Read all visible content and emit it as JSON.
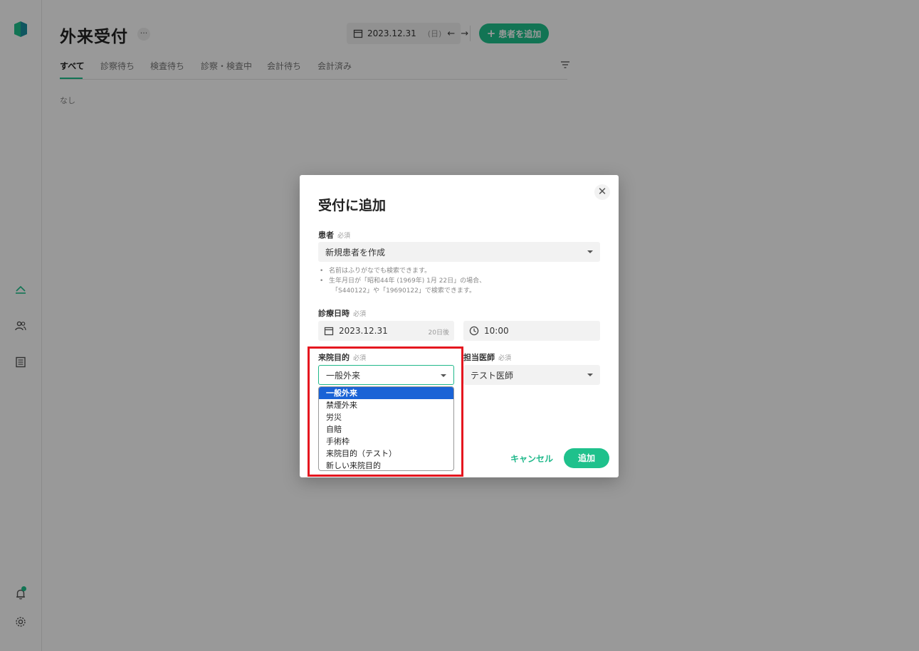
{
  "sidebar": {
    "items": [
      {
        "icon": "reception-icon",
        "active": true
      },
      {
        "icon": "patients-icon"
      },
      {
        "icon": "records-icon"
      }
    ],
    "bottom": [
      {
        "icon": "notification-bell-icon",
        "has_badge": true
      },
      {
        "icon": "gear-icon"
      }
    ]
  },
  "header": {
    "title": "外来受付",
    "more": "···",
    "date": "2023.12.31",
    "day_of_week": "(日)",
    "prev": "←",
    "next": "→",
    "add_patient_plus": "+",
    "add_patient_label": "患者を追加"
  },
  "tabs": [
    {
      "label": "すべて",
      "active": true
    },
    {
      "label": "診察待ち"
    },
    {
      "label": "検査待ち"
    },
    {
      "label": "診察・検査中"
    },
    {
      "label": "会計待ち"
    },
    {
      "label": "会計済み"
    }
  ],
  "main": {
    "empty_text": "なし"
  },
  "modal": {
    "title": "受付に追加",
    "close": "✕",
    "patient": {
      "label": "患者",
      "required": "必須",
      "value": "新規患者を作成",
      "hints": {
        "hint1": "名前はふりがなでも検索できます。",
        "hint2_line1": "生年月日が「昭和44年 (1969年) 1月 22日」の場合、",
        "hint2_line2": "「S440122」や「19690122」で検索できます。"
      }
    },
    "datetime": {
      "label": "診療日時",
      "required": "必須",
      "date": "2023.12.31",
      "days_after": "20日後",
      "time": "10:00"
    },
    "purpose": {
      "label": "来院目的",
      "required": "必須",
      "value": "一般外来",
      "options": [
        "一般外来",
        "禁煙外来",
        "労災",
        "自賠",
        "手術枠",
        "来院目的（テスト）",
        "新しい来院目的"
      ],
      "selected_index": 0
    },
    "doctor": {
      "label": "担当医師",
      "required": "必須",
      "value": "テスト医師"
    },
    "cancel_label": "キャンセル",
    "submit_label": "追加"
  },
  "colors": {
    "accent": "#1fc18c",
    "highlight_box": "#e5161f",
    "selected_option": "#1a63d6"
  }
}
